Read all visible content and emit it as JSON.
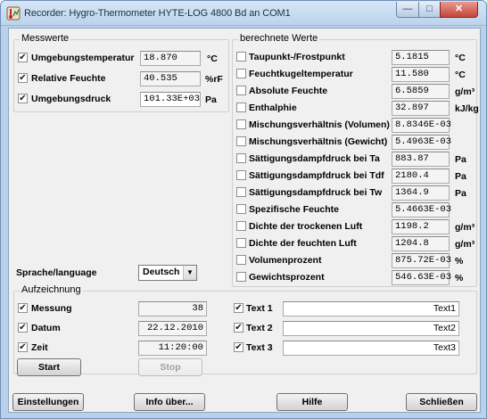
{
  "window": {
    "title": "Recorder: Hygro-Thermometer HYTE-LOG 4800 Bd an COM1",
    "min_glyph": "—",
    "max_glyph": "□",
    "close_glyph": "✕"
  },
  "messwerte": {
    "label": "Messwerte",
    "rows": [
      {
        "label": "Umgebungstemperatur",
        "value": "18.870",
        "unit": "°C",
        "checked": true
      },
      {
        "label": "Relative Feuchte",
        "value": "40.535",
        "unit": "%rF",
        "checked": true
      },
      {
        "label": "Umgebungsdruck",
        "value": "101.33E+03",
        "unit": "Pa",
        "checked": true
      }
    ]
  },
  "berechnete": {
    "label": "berechnete Werte",
    "rows": [
      {
        "label": "Taupunkt-/Frostpunkt",
        "value": "5.1815",
        "unit": "°C"
      },
      {
        "label": "Feuchtkugeltemperatur",
        "value": "11.580",
        "unit": "°C"
      },
      {
        "label": "Absolute Feuchte",
        "value": "6.5859",
        "unit": "g/m³"
      },
      {
        "label": "Enthalphie",
        "value": "32.897",
        "unit": "kJ/kg"
      },
      {
        "label": "Mischungsverhältnis (Volumen)",
        "value": "8.8346E-03",
        "unit": ""
      },
      {
        "label": "Mischungsverhältnis (Gewicht)",
        "value": "5.4963E-03",
        "unit": ""
      },
      {
        "label": "Sättigungsdampfdruck bei Ta",
        "value": "883.87",
        "unit": "Pa"
      },
      {
        "label": "Sättigungsdampfdruck bei Tdf",
        "value": "2180.4",
        "unit": "Pa"
      },
      {
        "label": "Sättigungsdampfdruck bei Tw",
        "value": "1364.9",
        "unit": "Pa"
      },
      {
        "label": "Spezifische Feuchte",
        "value": "5.4663E-03",
        "unit": ""
      },
      {
        "label": "Dichte der trockenen Luft",
        "value": "1198.2",
        "unit": "g/m³"
      },
      {
        "label": "Dichte der feuchten Luft",
        "value": "1204.8",
        "unit": "g/m³"
      },
      {
        "label": "Volumenprozent",
        "value": "875.72E-03",
        "unit": "%"
      },
      {
        "label": "Gewichtsprozent",
        "value": "546.63E-03",
        "unit": "%"
      }
    ]
  },
  "language": {
    "label": "Sprache/language",
    "value": "Deutsch"
  },
  "aufzeichnung": {
    "label": "Aufzeichnung",
    "rows": [
      {
        "label": "Messung",
        "value": "38",
        "checked": true
      },
      {
        "label": "Datum",
        "value": "22.12.2010",
        "checked": true
      },
      {
        "label": "Zeit",
        "value": "11:20:00",
        "checked": true
      }
    ],
    "texts": [
      {
        "label": "Text 1",
        "value": "Text1",
        "checked": true
      },
      {
        "label": "Text 2",
        "value": "Text2",
        "checked": true
      },
      {
        "label": "Text 3",
        "value": "Text3",
        "checked": true
      }
    ],
    "start": "Start",
    "stop": "Stop"
  },
  "footer": {
    "einstellungen": "Einstellungen",
    "info": "Info über...",
    "hilfe": "Hilfe",
    "schliessen": "Schließen"
  },
  "check_glyph": "✔"
}
